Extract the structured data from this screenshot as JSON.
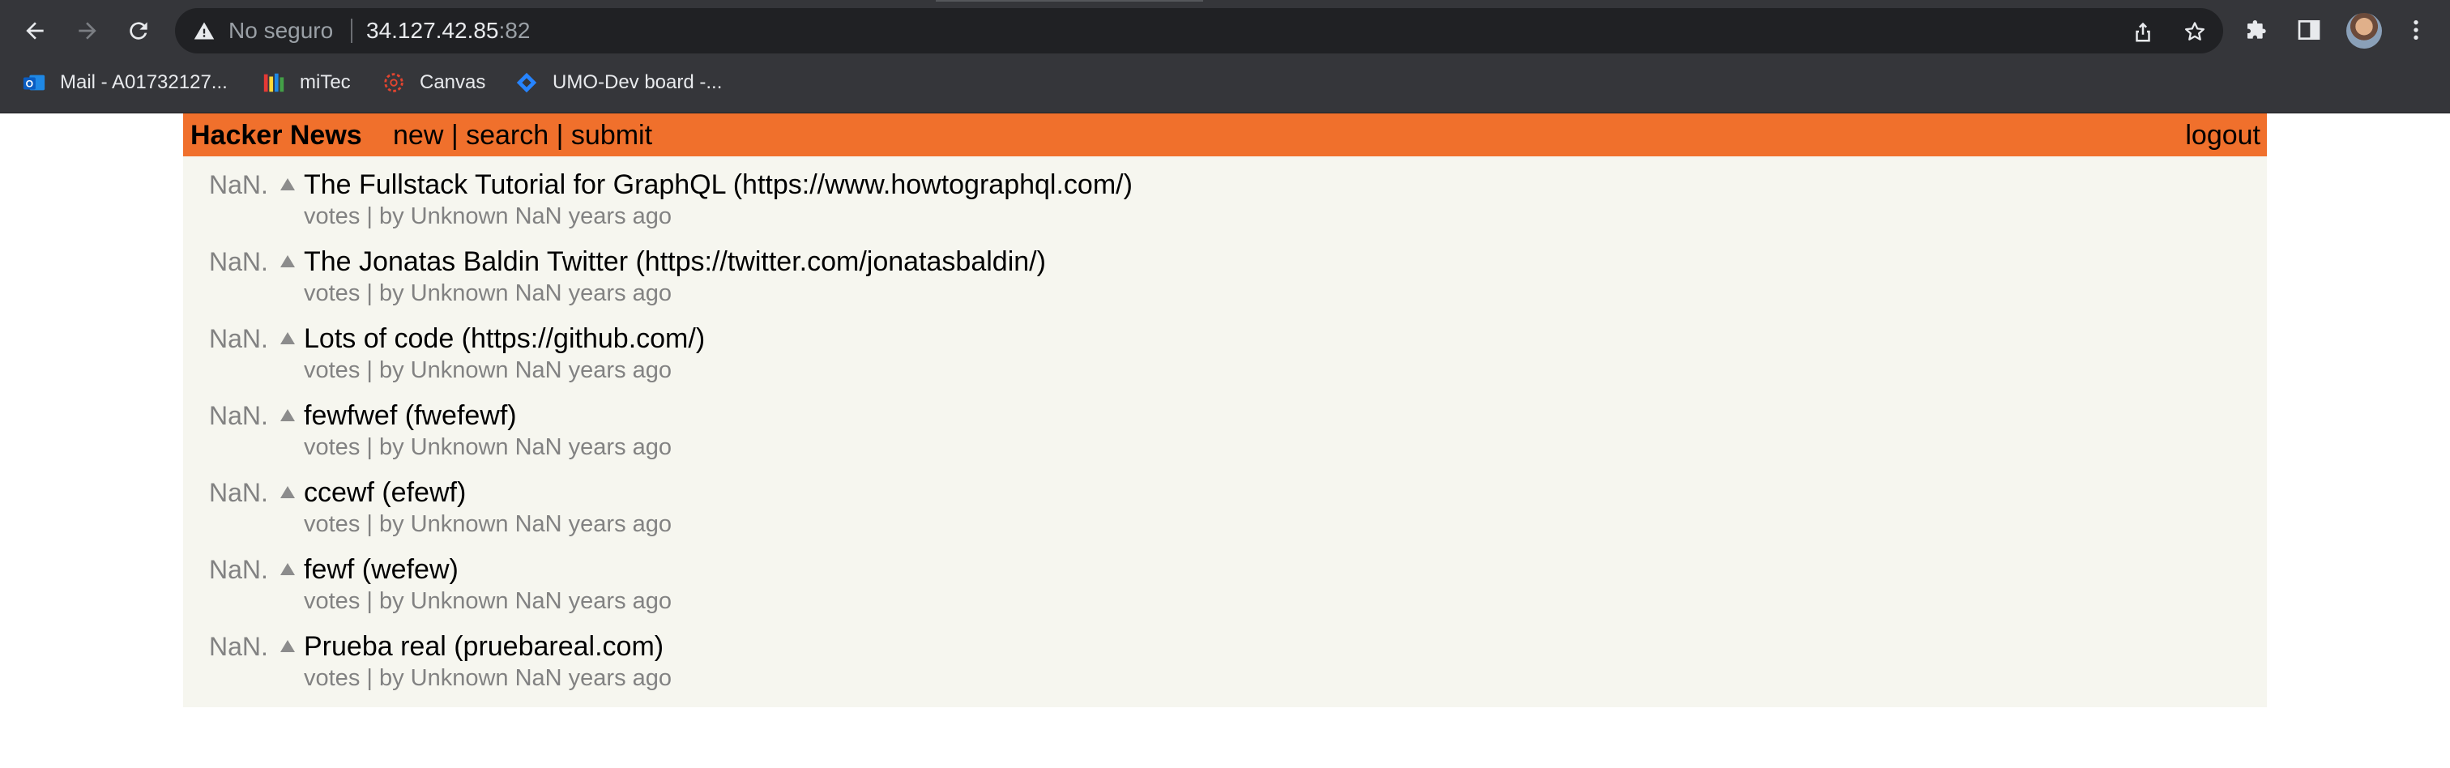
{
  "browser": {
    "security_label": "No seguro",
    "url_host": "34.127.42.85",
    "url_port": ":82",
    "icons": {
      "back": "arrow-left-icon",
      "forward": "arrow-right-icon",
      "reload": "reload-icon",
      "warning": "warning-triangle-icon",
      "share": "share-icon",
      "bookmark": "star-icon",
      "extensions": "puzzle-icon",
      "side_panel": "side-panel-icon",
      "menu": "kebab-menu-icon"
    },
    "bookmarks": [
      {
        "label": "Mail - A01732127...",
        "icon": "outlook-icon"
      },
      {
        "label": "miTec",
        "icon": "books-icon"
      },
      {
        "label": "Canvas",
        "icon": "canvas-icon"
      },
      {
        "label": "UMO-Dev board -...",
        "icon": "jira-icon"
      }
    ]
  },
  "header": {
    "brand": "Hacker News",
    "links": {
      "new": "new",
      "sep1": " | ",
      "search": "search",
      "sep2": " | ",
      "submit": "submit"
    },
    "logout": "logout",
    "accent_color": "#f0702c",
    "background_color": "#f6f6ef"
  },
  "stories": [
    {
      "rank": "NaN.",
      "title": "The Fullstack Tutorial for GraphQL (https://www.howtographql.com/)",
      "meta": "votes | by Unknown NaN years ago"
    },
    {
      "rank": "NaN.",
      "title": "The Jonatas Baldin Twitter (https://twitter.com/jonatasbaldin/)",
      "meta": "votes | by Unknown NaN years ago"
    },
    {
      "rank": "NaN.",
      "title": "Lots of code (https://github.com/)",
      "meta": "votes | by Unknown NaN years ago"
    },
    {
      "rank": "NaN.",
      "title": "fewfwef (fwefewf)",
      "meta": "votes | by Unknown NaN years ago"
    },
    {
      "rank": "NaN.",
      "title": "ccewf (efewf)",
      "meta": "votes | by Unknown NaN years ago"
    },
    {
      "rank": "NaN.",
      "title": "fewf (wefew)",
      "meta": "votes | by Unknown NaN years ago"
    },
    {
      "rank": "NaN.",
      "title": "Prueba real (pruebareal.com)",
      "meta": "votes | by Unknown NaN years ago"
    }
  ]
}
